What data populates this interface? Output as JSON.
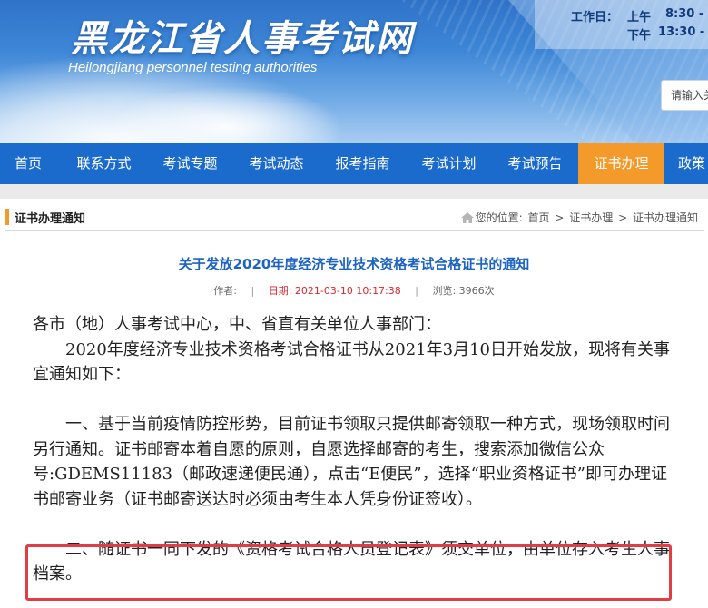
{
  "header": {
    "site_title": "黑龙江省人事考试网",
    "site_subtitle": "Heilongjiang personnel testing authorities",
    "hours_label": "工作日：",
    "hours_am_label": "上午",
    "hours_am_time": "8:30 -",
    "hours_pm_label": "下午",
    "hours_pm_time": "13:30 -",
    "search_placeholder": "请输入关"
  },
  "nav": {
    "items": [
      {
        "label": "首页"
      },
      {
        "label": "联系方式"
      },
      {
        "label": "考试专题"
      },
      {
        "label": "考试动态"
      },
      {
        "label": "报考指南"
      },
      {
        "label": "考试计划"
      },
      {
        "label": "考试预告"
      },
      {
        "label": "证书办理"
      },
      {
        "label": "政策"
      }
    ],
    "active_index": 7,
    "active_color": "#f49a2a",
    "bar_color": "#1b6bcc"
  },
  "section": {
    "title": "证书办理通知",
    "location_label": "您的位置:",
    "crumbs": [
      "首页",
      "证书办理",
      "证书办理通知"
    ],
    "crumb_sep": ">"
  },
  "article": {
    "title": "关于发放2020年度经济专业技术资格考试合格证书的通知",
    "author_label": "作者:",
    "date": "日期: 2021-03-10 10:17:38",
    "views": "浏览: 3966次",
    "meta_sep": "|",
    "greeting": "各市（地）人事考试中心，中、省直有关单位人事部门：",
    "intro": "2020年度经济专业技术资格考试合格证书从2021年3月10日开始发放，现将有关事宜通知如下：",
    "para1": "一、基于当前疫情防控形势，目前证书领取只提供邮寄领取一种方式，现场领取时间另行通知。证书邮寄本着自愿的原则，自愿选择邮寄的考生，搜索添加微信公众号:GDEMS11183（邮政速递便民通），点击“E便民”，选择“职业资格证书”即可办理证书邮寄业务（证书邮寄送达时必须由考生本人凭身份证签收）。",
    "para2": "二、随证书一同下发的《资格考试合格人员登记表》须交单位，由单位存入考生人事档案。",
    "title_color": "#1c63c2",
    "date_color": "#e0262b",
    "highlight_color": "#e23c44"
  }
}
